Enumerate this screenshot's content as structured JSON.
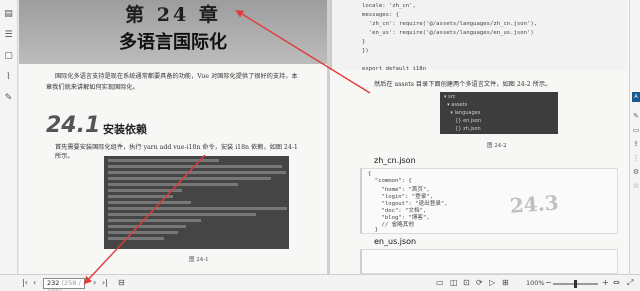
{
  "left_toolbar": {
    "icons": [
      "thumbnails-icon",
      "toc-icon",
      "comment-icon",
      "attachment-icon",
      "signature-icon"
    ]
  },
  "left_page": {
    "chapter_number": "第 24 章",
    "chapter_title": "多语言国际化",
    "intro_line1": "国际化多语言支持是现在系统通常都要具备的功能，Vue 对国际化提供了很好的支持，本",
    "intro_line2": "章我们就来讲解如何实现国际化。",
    "section_number": "24.1",
    "section_title": "安装依赖",
    "install_text": "首先需要安装国际化组件，执行 yarn add vue-i18n 命令，安装 i18n 依赖，如图 24-1 所示。",
    "figure_caption": "图 24-1"
  },
  "right_page": {
    "code_top": [
      "locale: 'zh_cn',",
      "messages: {",
      "  'zh_cn': require('@/assets/languages/zh_cn.json'),",
      "  'en_us': require('@/assets/languages/en_us.json')",
      "}",
      "})",
      "",
      "export default i18n"
    ],
    "instruction": "然后在 assets 目录下面创建两个多语言文件，如图 24-2 所示。",
    "tree": [
      "▾ src",
      "  ▾ assets",
      "    ▾ languages",
      "       {} en.json",
      "       {} zh.json"
    ],
    "figure_caption": "图 24-2",
    "file1_title": "zh_cn.json",
    "zh_code": [
      "{",
      "  \"common\": {",
      "    \"home\": \"首页\",",
      "    \"login\": \"登录\",",
      "    \"logout\": \"退出登录\",",
      "    \"doc\": \"文档\",",
      "    \"blog\": \"博客\",",
      "    // 省略其他",
      "  }",
      "}"
    ],
    "file2_title": "en_us.json",
    "overlay_text": "24.3"
  },
  "statusbar": {
    "current_page": "232",
    "total_pages": "(258 / 480)",
    "zoom": "100%",
    "icons": [
      "first-page-icon",
      "prev-page-icon",
      "next-page-icon",
      "last-page-icon",
      "fit-page-icon",
      "single-page-icon",
      "two-page-icon",
      "fullscreen-icon",
      "rotate-icon",
      "play-icon",
      "grid-icon",
      "zoom-out-icon",
      "zoom-in-icon",
      "fit-width-icon",
      "expand-icon"
    ]
  },
  "annotation_color": "#e23b3b"
}
